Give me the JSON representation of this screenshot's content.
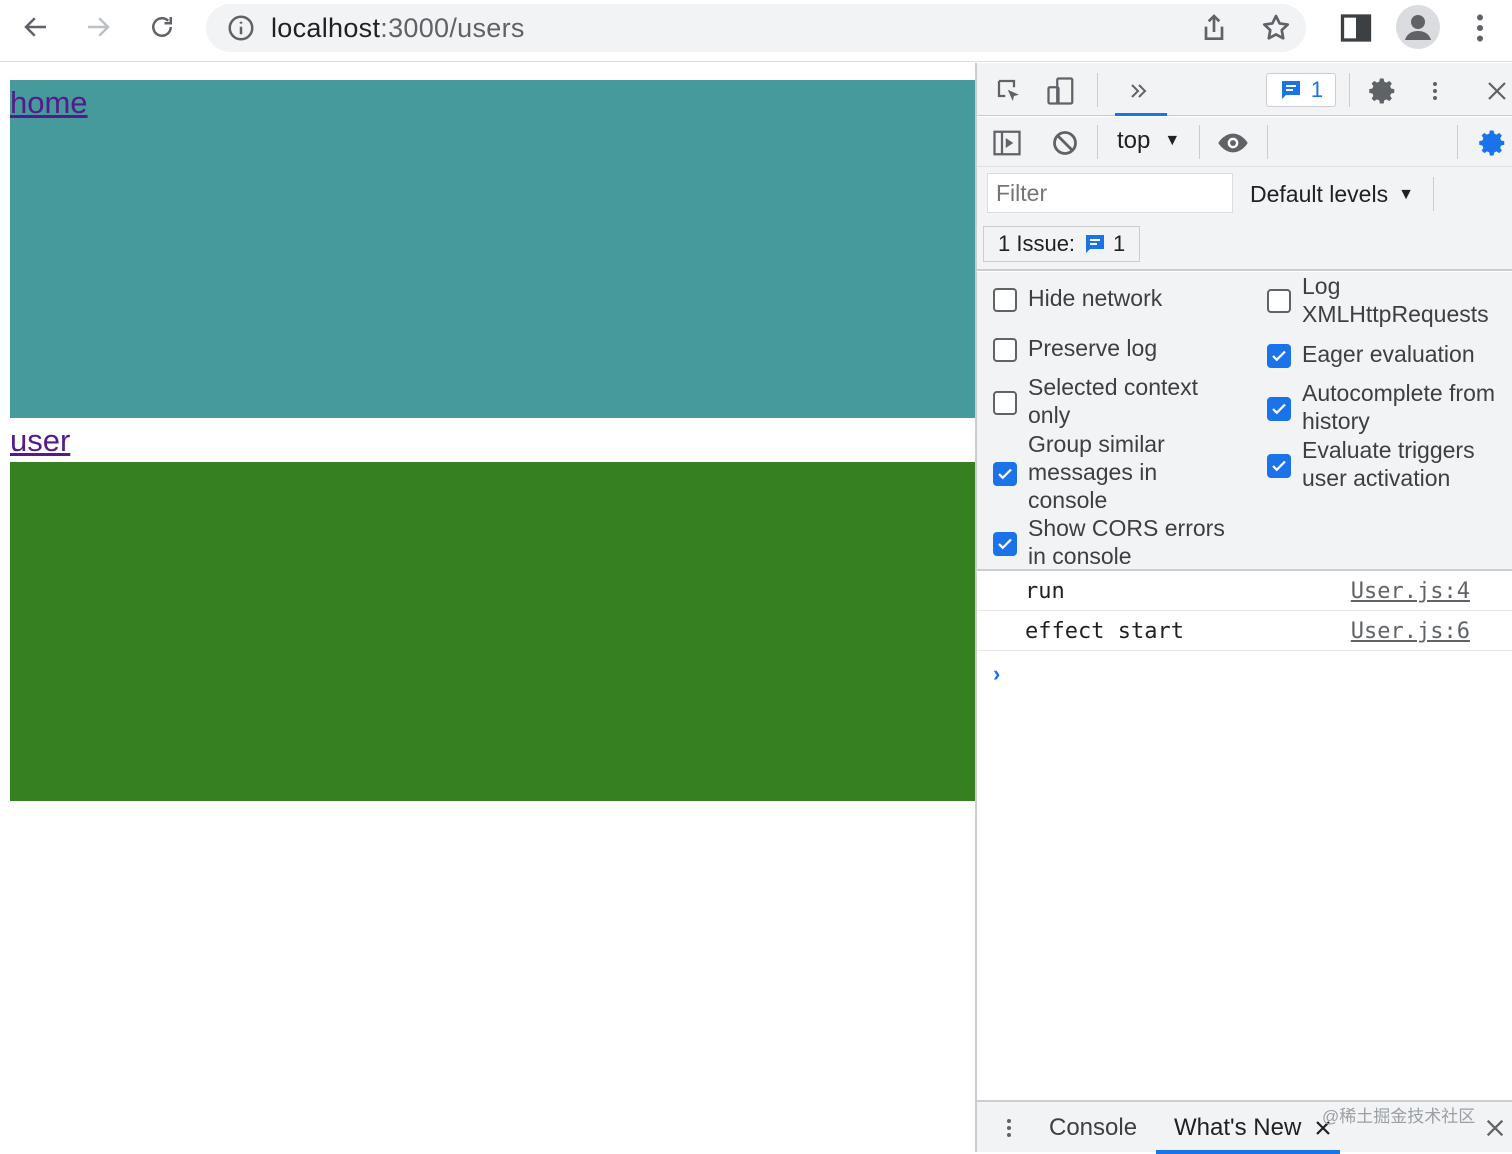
{
  "browser": {
    "url_host": "localhost",
    "url_path": ":3000/users"
  },
  "page": {
    "home_link": "home",
    "user_link": "user",
    "colors": {
      "home_block": "#469a9b",
      "user_block": "#378021",
      "link": "#551a8b"
    }
  },
  "devtools": {
    "issues_badge_count": "1",
    "context": "top",
    "filter_placeholder": "Filter",
    "levels_label": "Default levels",
    "issue_button_label": "1 Issue:",
    "issue_button_count": "1",
    "settings": {
      "hide_network": {
        "label": "Hide network",
        "checked": false
      },
      "log_xhr": {
        "label": "Log XMLHttpRequests",
        "checked": false
      },
      "preserve_log": {
        "label": "Preserve log",
        "checked": false
      },
      "eager_eval": {
        "label": "Eager evaluation",
        "checked": true
      },
      "selected_context": {
        "label": "Selected context only",
        "checked": false
      },
      "autocomplete": {
        "label": "Autocomplete from history",
        "checked": true
      },
      "group_similar": {
        "label": "Group similar messages in console",
        "checked": true
      },
      "evaluate_triggers": {
        "label": "Evaluate triggers user activation",
        "checked": true
      },
      "show_cors": {
        "label": "Show CORS errors in console",
        "checked": true
      }
    },
    "messages": [
      {
        "text": "run",
        "source": "User.js:4"
      },
      {
        "text": "effect start",
        "source": "User.js:6"
      }
    ],
    "drawer": {
      "tab_console": "Console",
      "tab_whats_new": "What's New",
      "watermark": "@稀土掘金技术社区"
    },
    "accent": "#1a73e8"
  }
}
